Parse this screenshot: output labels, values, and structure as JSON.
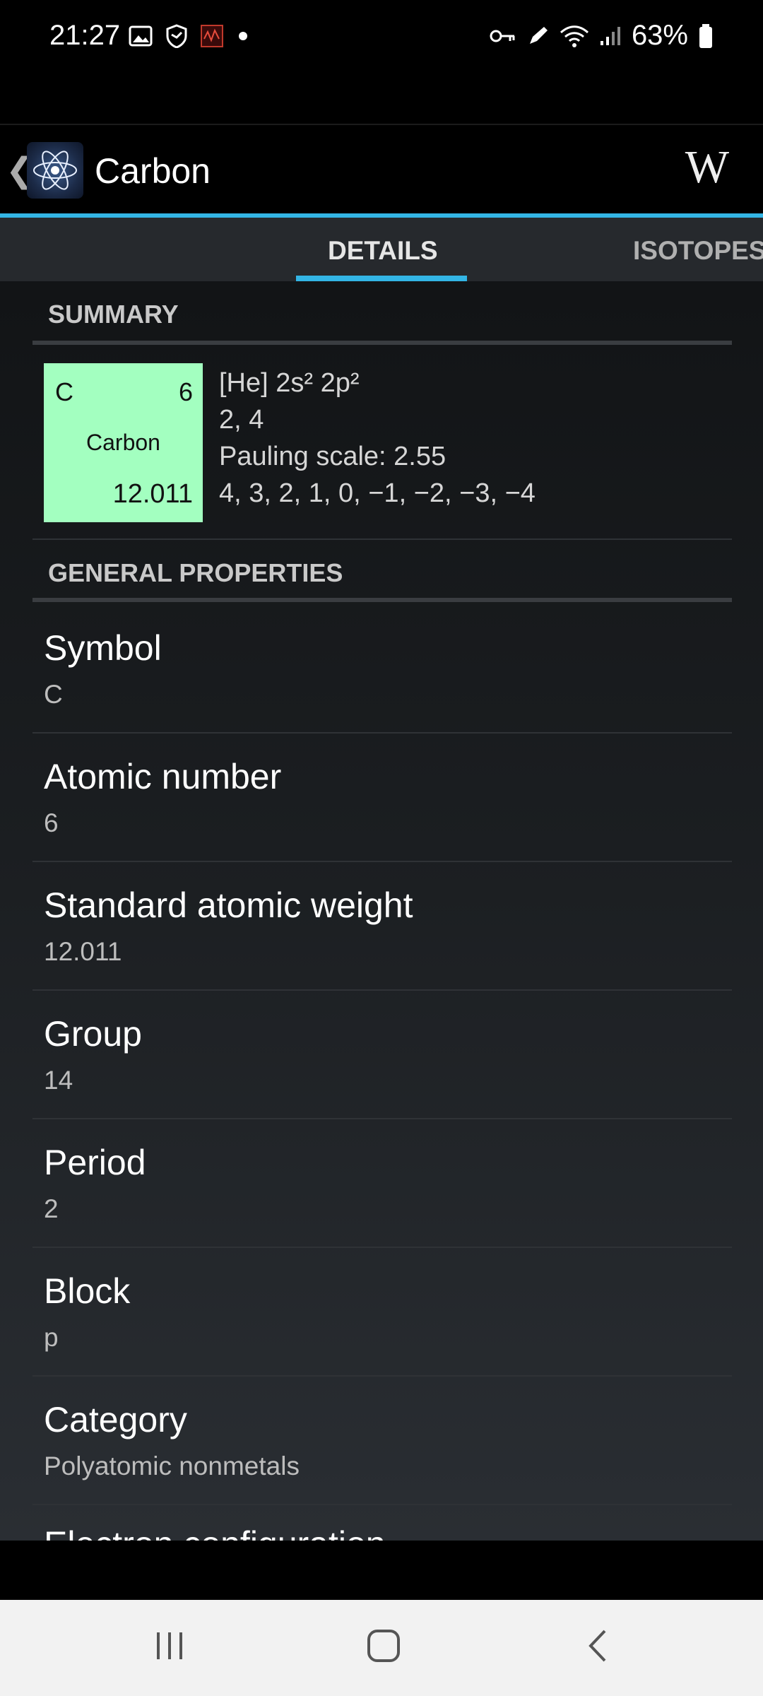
{
  "status_bar": {
    "time": "21:27",
    "battery": "63%",
    "left_icons": [
      "image-icon",
      "shield-icon",
      "app-red-icon",
      "dot-icon"
    ],
    "right_icons": [
      "key-icon",
      "pen-icon",
      "wifi-icon",
      "signal-icon",
      "battery-icon"
    ]
  },
  "toolbar": {
    "title": "Carbon",
    "wiki_label": "W",
    "back_icon": "chevron-left-icon",
    "logo_icon": "atom-icon"
  },
  "tabs": [
    {
      "label": "DETAILS"
    },
    {
      "label": "ISOTOPES"
    }
  ],
  "summary": {
    "header": "SUMMARY",
    "tile": {
      "symbol": "C",
      "number": "6",
      "name": "Carbon",
      "weight": "12.011",
      "color": "#a3ffc0"
    },
    "electron_config": "[He] 2s² 2p²",
    "electrons_per_shell": "2, 4",
    "electronegativity": "Pauling scale: 2.55",
    "oxidation_states": "4, 3, 2, 1, 0, −1, −2, −3, −4"
  },
  "general": {
    "header": "GENERAL PROPERTIES",
    "properties": [
      {
        "label": "Symbol",
        "value": "C"
      },
      {
        "label": "Atomic number",
        "value": "6"
      },
      {
        "label": "Standard atomic weight",
        "value": "12.011"
      },
      {
        "label": "Group",
        "value": "14"
      },
      {
        "label": "Period",
        "value": "2"
      },
      {
        "label": "Block",
        "value": "p"
      },
      {
        "label": "Category",
        "value": "Polyatomic nonmetals"
      },
      {
        "label": "Electron configuration",
        "value": ""
      }
    ]
  },
  "colors": {
    "accent": "#33b5e5",
    "tile": "#a3ffc0"
  },
  "nav": {
    "recents_icon": "recents-icon",
    "home_icon": "home-icon",
    "back_icon": "back-icon"
  }
}
